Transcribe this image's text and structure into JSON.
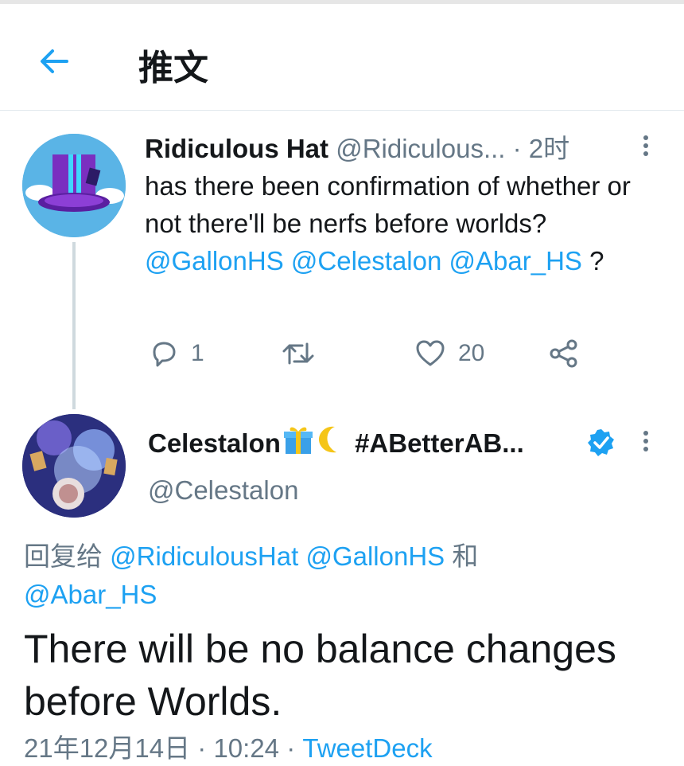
{
  "header": {
    "title": "推文"
  },
  "tweet1": {
    "display_name": "Ridiculous Hat",
    "handle": "@Ridiculous...",
    "separator": " · ",
    "time": "2时",
    "text_1": "has there been confirmation of whether or not there'll be nerfs before worlds? ",
    "mention_1": "@GallonHS",
    "mention_2": "@Celestalon",
    "mention_3": "@Abar_HS",
    "text_2": " ?",
    "reply_count": "1",
    "like_count": "20"
  },
  "tweet2": {
    "display_name_1": "Celestalon",
    "display_name_2": "#ABetterAB...",
    "handle": "@Celestalon",
    "reply_prefix": "回复给 ",
    "reply_mention_1": "@RidiculousHat",
    "reply_mention_2": "@GallonHS",
    "reply_and": " 和 ",
    "reply_mention_3": "@Abar_HS",
    "text": "There will be no balance changes before Worlds.",
    "date": "21年12月14日 · 10:24 · ",
    "source": "TweetDeck"
  },
  "colors": {
    "accent": "#1da1f2",
    "muted": "#657786",
    "divider": "#e1e8ed"
  },
  "icons": [
    "back-arrow-icon",
    "more-icon",
    "reply-icon",
    "retweet-icon",
    "like-icon",
    "share-icon",
    "verified-icon",
    "gift-icon",
    "moon-icon"
  ]
}
